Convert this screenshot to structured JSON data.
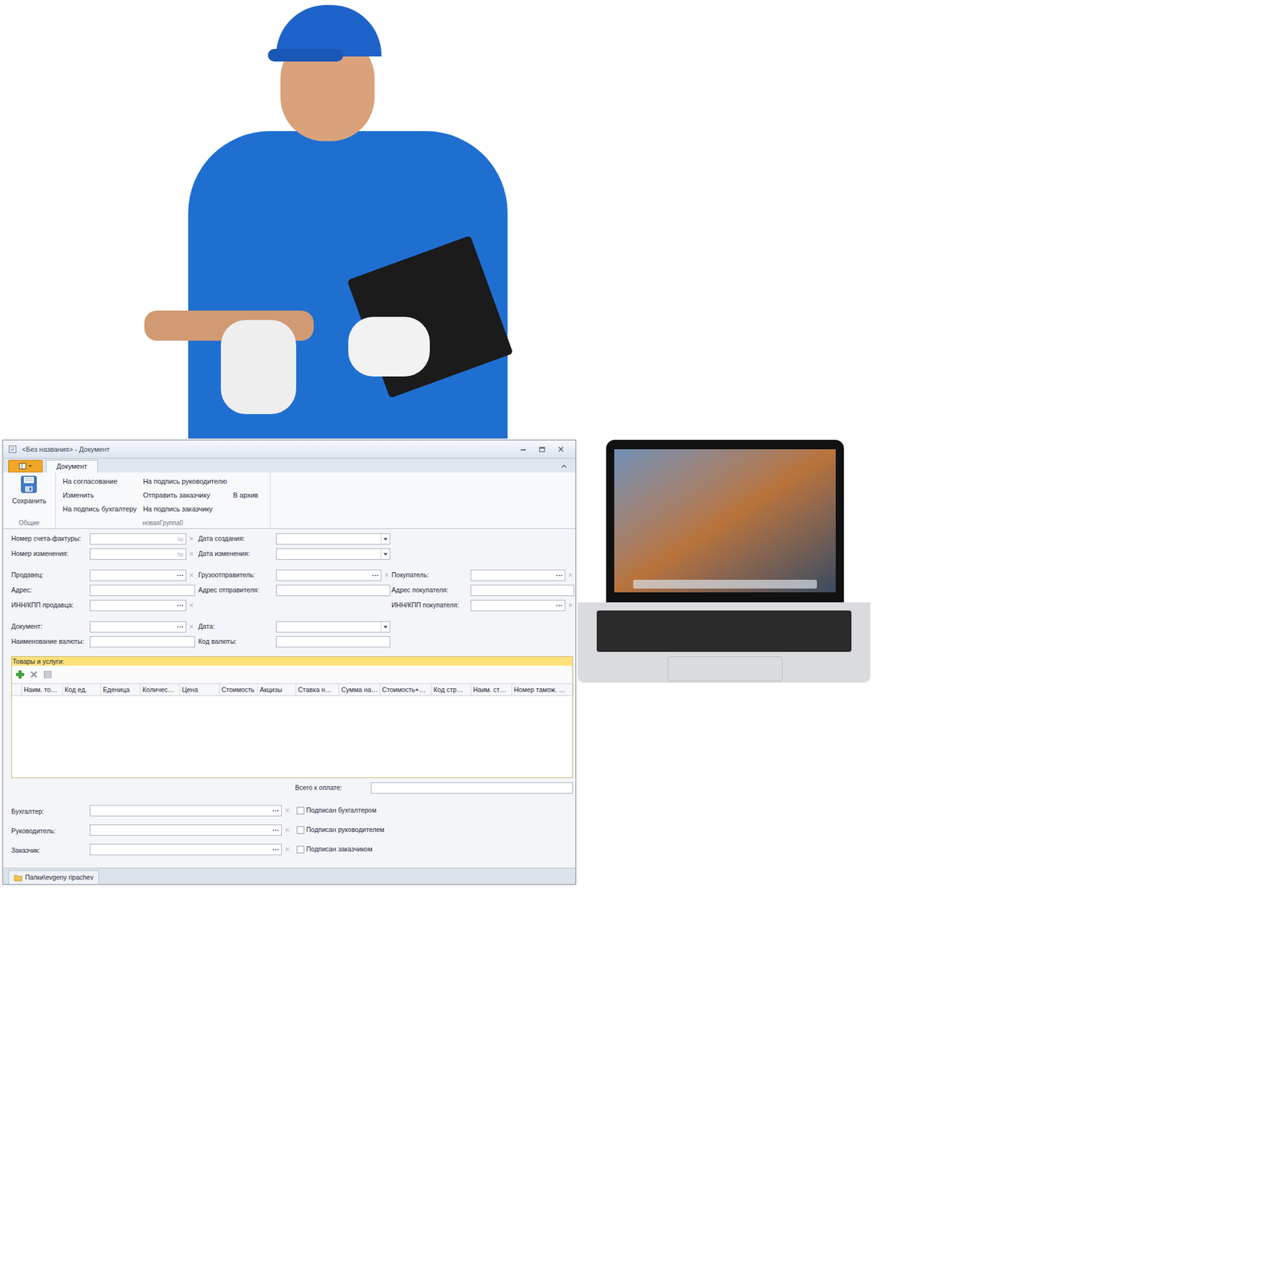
{
  "window": {
    "title": "<Без названия> - Документ"
  },
  "ribbon": {
    "tabs": [
      {
        "label": "Документ",
        "selected": true
      }
    ],
    "save_group": {
      "label": "Общие",
      "button": "Сохранить"
    },
    "actions_group": {
      "label": "новаяГруппа0",
      "columns": [
        [
          "На согласование",
          "Изменить",
          "На подпись бухгалтеру"
        ],
        [
          "На подпись руководителю",
          "Отправить заказчику",
          "На подпись заказчику"
        ],
        [
          "В архив"
        ]
      ]
    }
  },
  "form": {
    "groups": [
      [
        [
          {
            "label": "Номер счета-фактуры:",
            "kind": "number",
            "buttons": [
              "№",
              "×"
            ]
          },
          {
            "label": "Дата создания:",
            "kind": "date",
            "buttons": []
          }
        ],
        [
          {
            "label": "Номер изменения:",
            "kind": "number",
            "buttons": [
              "№",
              "×"
            ]
          },
          {
            "label": "Дата изменения:",
            "kind": "date",
            "buttons": []
          }
        ]
      ],
      [
        [
          {
            "label": "Продавец:",
            "kind": "lookup",
            "buttons": [
              "···",
              "×"
            ]
          },
          {
            "label": "Грузоотправитель:",
            "kind": "lookup",
            "buttons": [
              "···",
              "×"
            ]
          },
          {
            "label": "Покупатель:",
            "kind": "lookup",
            "buttons": [
              "···",
              "×"
            ]
          }
        ],
        [
          {
            "label": "Адрес:",
            "kind": "text",
            "buttons": []
          },
          {
            "label": "Адрес отправителя:",
            "kind": "text",
            "buttons": []
          },
          {
            "label": "Адрес покупателя:",
            "kind": "text",
            "buttons": []
          }
        ],
        [
          {
            "label": "ИНН/КПП продавца:",
            "kind": "lookup",
            "buttons": [
              "···",
              "×"
            ]
          },
          null,
          {
            "label": "ИНН/КПП покупателя:",
            "kind": "lookup",
            "buttons": [
              "···",
              "×"
            ]
          }
        ]
      ],
      [
        [
          {
            "label": "Документ:",
            "kind": "lookup",
            "buttons": [
              "···",
              "×"
            ]
          },
          {
            "label": "Дата:",
            "kind": "date",
            "buttons": []
          }
        ],
        [
          {
            "label": "Наименование валюты:",
            "kind": "text",
            "buttons": []
          },
          {
            "label": "Код валюты:",
            "kind": "text",
            "buttons": []
          }
        ]
      ]
    ]
  },
  "goods": {
    "title": "Товары и услуги:",
    "columns": [
      "",
      "Наим. то…",
      "Код ед.",
      "Еденица",
      "Количес…",
      "Цена",
      "Стоимость",
      "Акцизы",
      "Ставка н…",
      "Сумма на…",
      "Стоимость+…",
      "Код стр…",
      "Наим. ст…",
      "Номер тамож. …"
    ]
  },
  "total": {
    "label": "Всего к оплате:"
  },
  "signers": [
    {
      "label": "Бухгалтер:",
      "buttons": [
        "···",
        "×"
      ],
      "checkbox": "Подписан бухгалтером",
      "checked": false
    },
    {
      "label": "Руководитель:",
      "buttons": [
        "···",
        "×"
      ],
      "checkbox": "Подписан руководителем",
      "checked": false
    },
    {
      "label": "Заказчик:",
      "buttons": [
        "···",
        "×"
      ],
      "checkbox": "Подписан заказчиком",
      "checked": false
    }
  ],
  "status_bar": {
    "path": "Папки\\evgeny ripachev"
  }
}
